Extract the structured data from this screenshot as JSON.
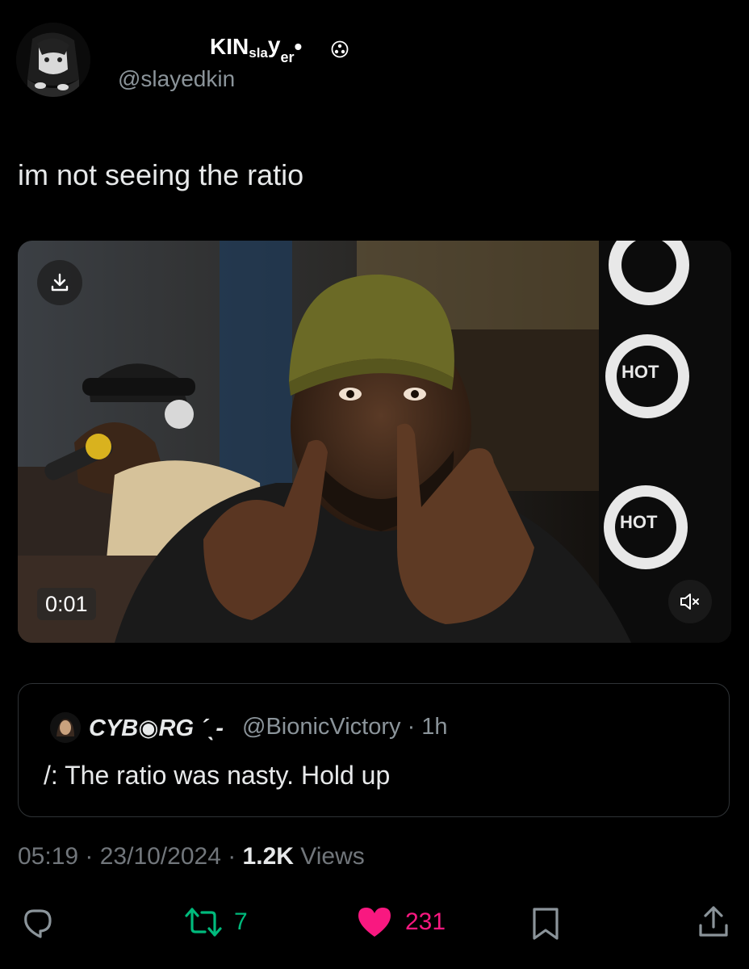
{
  "author": {
    "name_parts": [
      "KIN",
      "sla",
      "y",
      "er",
      "•"
    ],
    "handle": "@slayedkin"
  },
  "tweet": {
    "text": "im not seeing the ratio"
  },
  "video": {
    "timestamp": "0:01"
  },
  "quote": {
    "name": "CYB◉RG ˊˎ-",
    "handle_time": "@BionicVictory · 1h",
    "text": "/: The ratio was nasty. Hold up"
  },
  "meta": {
    "datetime": "05:19 · 23/10/2024 · ",
    "views_count": "1.2K",
    "views_label": " Views"
  },
  "actions": {
    "retweets": "7",
    "likes": "231"
  },
  "colors": {
    "background": "#000000",
    "retweet": "#00ba7c",
    "like": "#f91880",
    "muted": "#71767b"
  }
}
